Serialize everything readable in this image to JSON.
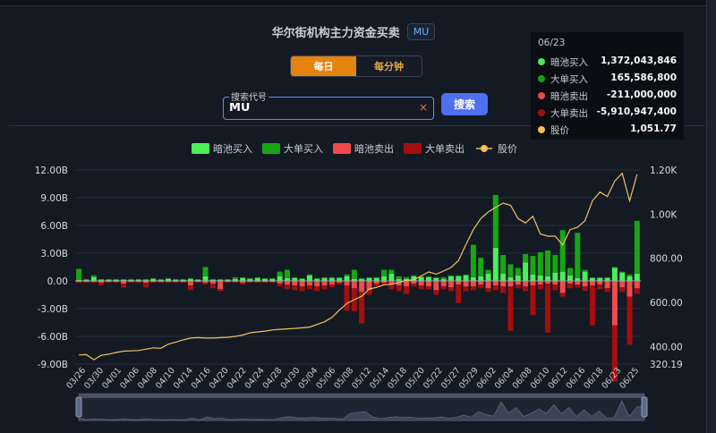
{
  "header": {
    "title": "华尔街机构主力资金买卖",
    "ticker_badge": "MU"
  },
  "period_toggle": {
    "daily_label": "每日",
    "minute_label": "每分钟"
  },
  "search": {
    "label": "搜索代号",
    "value": "MU",
    "clear_symbol": "×",
    "button_label": "搜索"
  },
  "tooltip": {
    "date": "06/23",
    "rows": [
      {
        "name": "暗池买入",
        "value": "1,372,043,846",
        "color": "#4bef5a"
      },
      {
        "name": "大单买入",
        "value": "165,586,800",
        "color": "#16a616"
      },
      {
        "name": "暗池卖出",
        "value": "-211,000,000",
        "color": "#f04b4b"
      },
      {
        "name": "大单卖出",
        "value": "-5,910,947,400",
        "color": "#a40e0e"
      },
      {
        "name": "股价",
        "value": "1,051.77",
        "color": "#f6c45a"
      }
    ]
  },
  "chart_data": {
    "type": "bar",
    "legend": [
      "暗池买入",
      "大单买入",
      "暗池卖出",
      "大单卖出",
      "股价"
    ],
    "legend_position": "top",
    "colors": {
      "dark_buy": "#4bef5a",
      "block_buy": "#16a616",
      "dark_sell": "#f04b4b",
      "block_sell": "#a40e0e",
      "price": "#f2c15e"
    },
    "x_tick_labels": [
      "03/26",
      "03/30",
      "04/01",
      "04/06",
      "04/08",
      "04/10",
      "04/14",
      "04/16",
      "04/20",
      "04/22",
      "04/24",
      "04/28",
      "04/30",
      "05/04",
      "05/06",
      "05/08",
      "05/12",
      "05/14",
      "05/18",
      "05/20",
      "05/22",
      "05/27",
      "05/29",
      "06/02",
      "06/04",
      "06/08",
      "06/10",
      "06/12",
      "06/16",
      "06/18",
      "06/23",
      "06/25"
    ],
    "y_left": {
      "ticks": [
        "12.00B",
        "9.00B",
        "6.00B",
        "3.00B",
        "0.00",
        "-3.00B",
        "-6.00B",
        "-9.00B"
      ],
      "range": [
        -9,
        12
      ],
      "unit": "B"
    },
    "y_right": {
      "ticks": [
        "1.20K",
        "1.00K",
        "800.00",
        "600.00",
        "400.00",
        "320.19"
      ],
      "range": [
        320.19,
        1200
      ]
    },
    "grid": "horizontal",
    "dark_buy": [
      0.1,
      0.1,
      0.4,
      0.1,
      0.1,
      0.1,
      0.1,
      0.1,
      0.1,
      0.1,
      0.2,
      0.1,
      0.2,
      0.1,
      0.1,
      0.2,
      0.1,
      0.5,
      0.1,
      0.1,
      0.1,
      0.2,
      0.3,
      0.2,
      0.3,
      0.2,
      0.2,
      0.5,
      0.3,
      0.3,
      0.2,
      0.6,
      0.2,
      0.3,
      0.3,
      0.3,
      0.5,
      0.2,
      0.2,
      0.3,
      0.3,
      0.5,
      0.8,
      0.2,
      0.2,
      0.5,
      0.4,
      0.4,
      0.3,
      0.2,
      0.5,
      0.5,
      0.6,
      0.4,
      0.5,
      0.8,
      3.6,
      0.8,
      0.4,
      0.6,
      2.0,
      0.7,
      0.6,
      0.5,
      0.9,
      1.0,
      0.6,
      0.3,
      1.0,
      0.3,
      0.3,
      0.3,
      1.4,
      0.9,
      0.5,
      0.8
    ],
    "block_buy": [
      1.2,
      0.1,
      0.2,
      0.1,
      0.1,
      0.1,
      0.1,
      0.1,
      0.1,
      0.1,
      0.1,
      0.1,
      0.1,
      0.1,
      0.1,
      0.1,
      0.1,
      1.0,
      0.1,
      0.1,
      0.1,
      0.2,
      0.1,
      0.1,
      0.1,
      0.1,
      0.1,
      0.5,
      0.9,
      0.1,
      0.1,
      0.1,
      0.1,
      0.1,
      0.1,
      0.1,
      0.2,
      1.0,
      0.1,
      0.1,
      0.1,
      0.7,
      0.4,
      0.3,
      0.2,
      0.1,
      0.1,
      0.1,
      0.1,
      0.2,
      0.1,
      0.1,
      0.1,
      3.5,
      2.0,
      0.4,
      5.7,
      2.0,
      1.4,
      0.8,
      0.9,
      2.0,
      2.5,
      2.8,
      1.9,
      4.5,
      0.8,
      4.9,
      0.2,
      0.1,
      0.1,
      0.1,
      0.1,
      0.1,
      0.2,
      5.7
    ],
    "dark_sell": [
      -0.1,
      -0.1,
      -0.1,
      -0.2,
      -0.1,
      -0.1,
      -0.3,
      -0.1,
      -0.1,
      -0.2,
      -0.1,
      -0.1,
      -0.1,
      -0.1,
      -0.1,
      -0.5,
      -0.1,
      -0.2,
      -0.3,
      -0.9,
      -0.1,
      -0.1,
      -0.2,
      -0.1,
      -0.1,
      -0.1,
      -0.1,
      -0.3,
      -0.4,
      -0.5,
      -0.6,
      -0.5,
      -0.6,
      -0.5,
      -0.4,
      -0.2,
      -0.5,
      -0.8,
      -1.2,
      -1.0,
      -0.3,
      -0.2,
      -0.4,
      -0.5,
      -0.6,
      -0.3,
      -0.5,
      -0.6,
      -1.0,
      -0.6,
      -0.7,
      -0.4,
      -0.6,
      -0.6,
      -0.4,
      -0.8,
      -0.5,
      -0.6,
      -0.6,
      -0.4,
      -0.6,
      -0.5,
      -0.4,
      -0.3,
      -0.4,
      -1.3,
      -0.3,
      -0.4,
      -0.6,
      -0.5,
      -0.4,
      -0.8,
      -4.8,
      -0.7,
      -1.7,
      -0.8
    ],
    "block_sell": [
      -0.1,
      -0.1,
      -0.1,
      -0.3,
      -0.1,
      -0.1,
      -0.4,
      -0.1,
      -0.1,
      -0.5,
      -0.1,
      -0.1,
      -0.1,
      -0.1,
      -0.1,
      -0.5,
      -0.1,
      -0.2,
      -0.5,
      -0.2,
      -0.1,
      -0.1,
      -0.2,
      -0.1,
      -0.1,
      -0.1,
      -0.1,
      -0.3,
      -0.5,
      -0.5,
      -0.5,
      -0.4,
      -0.5,
      -0.4,
      -0.3,
      -0.2,
      -2.7,
      -2.5,
      -3.4,
      -0.5,
      -0.3,
      -0.2,
      -0.5,
      -0.6,
      -0.8,
      -0.3,
      -0.4,
      -0.3,
      -0.5,
      -0.3,
      -0.4,
      -2.0,
      -0.5,
      -0.4,
      -0.4,
      -0.4,
      -0.5,
      -0.7,
      -4.8,
      -0.4,
      -0.5,
      -3.2,
      -0.5,
      -5.3,
      -0.6,
      -0.4,
      -0.5,
      -0.3,
      -0.5,
      -4.3,
      -0.5,
      -0.4,
      -6.1,
      -0.5,
      -5.2,
      -0.6
    ],
    "price": [
      362,
      363,
      340,
      360,
      365,
      373,
      379,
      380,
      382,
      388,
      394,
      392,
      410,
      420,
      430,
      438,
      440,
      438,
      438,
      440,
      442,
      446,
      452,
      462,
      466,
      470,
      475,
      478,
      480,
      482,
      485,
      488,
      500,
      512,
      532,
      565,
      595,
      612,
      628,
      660,
      668,
      680,
      682,
      690,
      700,
      702,
      720,
      738,
      728,
      742,
      758,
      790,
      862,
      930,
      980,
      1010,
      1030,
      1050,
      1040,
      980,
      960,
      990,
      910,
      900,
      900,
      860,
      930,
      940,
      970,
      1060,
      1100,
      1080,
      1150,
      1185,
      1060,
      1180
    ]
  }
}
